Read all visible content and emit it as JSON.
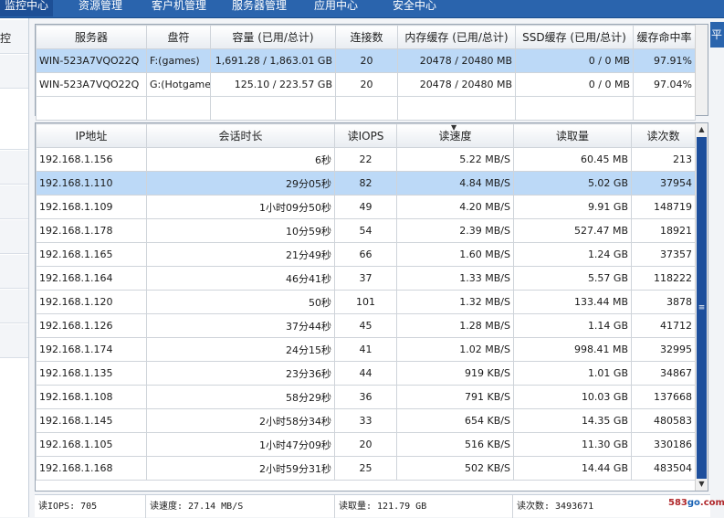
{
  "nav": {
    "tabs": [
      {
        "label": "监控中心",
        "active": true
      },
      {
        "label": "资源管理",
        "active": false
      },
      {
        "label": "客户机管理",
        "active": false
      },
      {
        "label": "服务器管理",
        "active": false
      },
      {
        "label": "应用中心",
        "active": false
      },
      {
        "label": "安全中心",
        "active": false
      }
    ],
    "right_button": "平"
  },
  "sidebar": {
    "items": [
      {
        "label": "控"
      },
      {
        "label": ""
      },
      {
        "label": ""
      },
      {
        "label": ""
      },
      {
        "label": ""
      },
      {
        "label": ""
      },
      {
        "label": ""
      },
      {
        "label": ""
      },
      {
        "label": ""
      }
    ]
  },
  "server_table": {
    "headers": [
      "服务器",
      "盘符",
      "容量 (已用/总计)",
      "连接数",
      "内存缓存 (已用/总计)",
      "SSD缓存 (已用/总计)",
      "缓存命中率"
    ],
    "rows": [
      [
        "WIN-523A7VQO22Q",
        "F:(games)",
        "1,691.28 / 1,863.01 GB",
        "20",
        "20478 / 20480 MB",
        "0 / 0 MB",
        "97.91%"
      ],
      [
        "WIN-523A7VQO22Q",
        "G:(Hotgame)",
        "125.10 / 223.57 GB",
        "20",
        "20478 / 20480 MB",
        "0 / 0 MB",
        "97.04%"
      ]
    ],
    "selected_row": 0
  },
  "session_table": {
    "headers": [
      "IP地址",
      "会话时长",
      "读IOPS",
      "读速度",
      "读取量",
      "读次数"
    ],
    "sorted_column": 3,
    "selected_row": 1,
    "rows": [
      [
        "192.168.1.156",
        "6秒",
        "22",
        "5.22 MB/S",
        "60.45 MB",
        "213"
      ],
      [
        "192.168.1.110",
        "29分05秒",
        "82",
        "4.84 MB/S",
        "5.02 GB",
        "37954"
      ],
      [
        "192.168.1.109",
        "1小时09分50秒",
        "49",
        "4.20 MB/S",
        "9.91 GB",
        "148719"
      ],
      [
        "192.168.1.178",
        "10分59秒",
        "54",
        "2.39 MB/S",
        "527.47 MB",
        "18921"
      ],
      [
        "192.168.1.165",
        "21分49秒",
        "66",
        "1.60 MB/S",
        "1.24 GB",
        "37357"
      ],
      [
        "192.168.1.164",
        "46分41秒",
        "37",
        "1.33 MB/S",
        "5.57 GB",
        "118222"
      ],
      [
        "192.168.1.120",
        "50秒",
        "101",
        "1.32 MB/S",
        "133.44 MB",
        "3878"
      ],
      [
        "192.168.1.126",
        "37分44秒",
        "45",
        "1.28 MB/S",
        "1.14 GB",
        "41712"
      ],
      [
        "192.168.1.174",
        "24分15秒",
        "41",
        "1.02 MB/S",
        "998.41 MB",
        "32995"
      ],
      [
        "192.168.1.135",
        "23分36秒",
        "44",
        "919 KB/S",
        "1.01 GB",
        "34867"
      ],
      [
        "192.168.1.108",
        "58分29秒",
        "36",
        "791 KB/S",
        "10.03 GB",
        "137668"
      ],
      [
        "192.168.1.145",
        "2小时58分34秒",
        "33",
        "654 KB/S",
        "14.35 GB",
        "480583"
      ],
      [
        "192.168.1.105",
        "1小时47分09秒",
        "20",
        "516 KB/S",
        "11.30 GB",
        "330186"
      ],
      [
        "192.168.1.168",
        "2小时59分31秒",
        "25",
        "502 KB/S",
        "14.44 GB",
        "483504"
      ]
    ]
  },
  "footer": {
    "read_iops": "读IOPS: 705",
    "read_speed": "读速度: 27.14 MB/S",
    "read_amount": "读取量: 121.79 GB",
    "read_count": "读次数: 3493671"
  },
  "watermark": {
    "prefix": "583",
    "middle": "go",
    "suffix": ".com"
  },
  "colors": {
    "nav_bg": "#2a64ad",
    "selected_row": "#bcd9f7",
    "scroll_thumb": "#1e4f9c"
  }
}
